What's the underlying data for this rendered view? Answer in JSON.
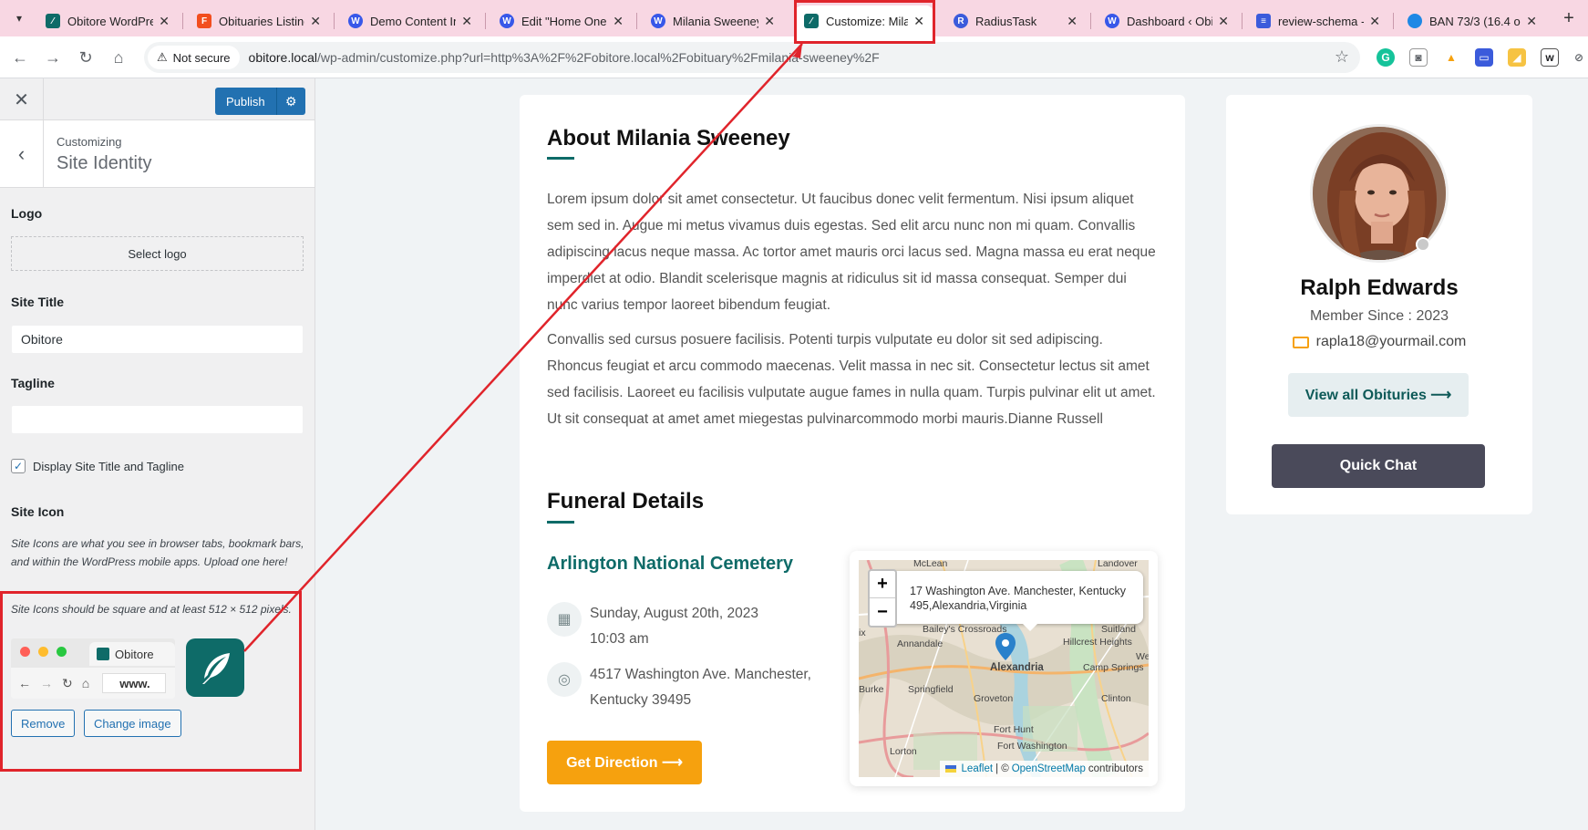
{
  "browser": {
    "tabs": [
      {
        "label": "Obitore WordPre",
        "icon": "obitore-icon",
        "color": "#0e6b68"
      },
      {
        "label": "Obituaries Listing",
        "icon": "figma-icon",
        "color": "#f24e1e"
      },
      {
        "label": "Demo Content In",
        "icon": "wordpress-icon",
        "color": "#3858e9"
      },
      {
        "label": "Edit \"Home One\"",
        "icon": "wordpress-icon",
        "color": "#3858e9"
      },
      {
        "label": "Milania Sweeney",
        "icon": "wordpress-icon",
        "color": "#3858e9"
      },
      {
        "label": "Customize: Milan",
        "icon": "obitore-icon",
        "color": "#0e6b68"
      },
      {
        "label": "RadiusTask",
        "icon": "radiustask-icon",
        "color": "#3b5bdb"
      },
      {
        "label": "Dashboard ‹ Obit",
        "icon": "wordpress-icon",
        "color": "#3858e9"
      },
      {
        "label": "review-schema - ",
        "icon": "schema-icon",
        "color": "#3b5bdb"
      },
      {
        "label": "BAN 73/3 (16.4 o",
        "icon": "cricket-icon",
        "color": "#1e88e5"
      }
    ],
    "active_tab_index": 5,
    "security_label": "Not secure",
    "url_host": "obitore.local",
    "url_path": "/wp-admin/customize.php?url=http%3A%2F%2Fobitore.local%2Fobituary%2Fmilania-sweeney%2F"
  },
  "customizer": {
    "publish_label": "Publish",
    "customizing_label": "Customizing",
    "section_title": "Site Identity",
    "logo_label": "Logo",
    "select_logo_label": "Select logo",
    "site_title_label": "Site Title",
    "site_title_value": "Obitore",
    "tagline_label": "Tagline",
    "tagline_value": "",
    "display_title_label": "Display Site Title and Tagline",
    "display_title_checked": true,
    "site_icon_label": "Site Icon",
    "site_icon_desc1": "Site Icons are what you see in browser tabs, bookmark bars, and within the WordPress mobile apps. Upload one here!",
    "site_icon_desc2": "Site Icons should be square and at least 512 × 512 pixels.",
    "preview_tab_label": "Obitore",
    "preview_url": "www.",
    "remove_label": "Remove",
    "change_image_label": "Change image"
  },
  "about": {
    "heading": "About Milania Sweeney",
    "para1": "Lorem ipsum dolor sit amet consectetur. Ut faucibus donec velit fermentum. Nisi ipsum aliquet sem sed in. Augue mi metus vivamus duis egestas. Sed elit arcu nunc non mi quam. Convallis adipiscing lacus neque massa. Ac tortor amet mauris orci lacus sed. Magna massa eu erat neque imperdiet at odio. Blandit scelerisque magnis at ridiculus sit id massa consequat. Semper dui nunc varius tempor laoreet bibendum feugiat.",
    "para2": "Convallis sed cursus posuere facilisis. Potenti turpis vulputate eu dolor sit sed adipiscing. Rhoncus feugiat et arcu commodo maecenas. Velit massa in nec sit. Consectetur lectus sit amet sed facilisis. Laoreet eu facilisis vulputate augue fames in nulla quam. Turpis pulvinar elit ut amet. Ut sit consequat at amet amet miegestas pulvinarcommodo morbi mauris.Dianne Russell"
  },
  "funeral": {
    "heading": "Funeral Details",
    "cemetery": "Arlington National Cemetery",
    "date": "Sunday, August 20th, 2023",
    "time": "10:03 am",
    "address_line1": "4517 Washington Ave. Manchester,",
    "address_line2": "Kentucky 39495",
    "direction_label": "Get Direction ⟶"
  },
  "map": {
    "popup_line1": "17 Washington Ave. Manchester, Kentucky",
    "popup_line2": "495,Alexandria,Virginia",
    "zoom_in": "+",
    "zoom_out": "−",
    "attrib_leaflet": "Leaflet",
    "attrib_osm": "OpenStreetMap",
    "attrib_suffix": "contributors",
    "places": [
      "McLean",
      "Landover",
      "Bailey's Crossroads",
      "Suitland",
      "Annandale",
      "Hillcrest Heights",
      "Alexandria",
      "Camp Springs",
      "Burke",
      "Springfield",
      "Groveton",
      "Clinton",
      "Fort Hunt",
      "Fort Washington",
      "Lorton",
      "ix",
      "We"
    ]
  },
  "profile": {
    "name": "Ralph Edwards",
    "member_since": "Member Since : 2023",
    "email": "rapla18@yourmail.com",
    "view_all_label": "View all Obituries ⟶",
    "quick_chat_label": "Quick Chat"
  }
}
